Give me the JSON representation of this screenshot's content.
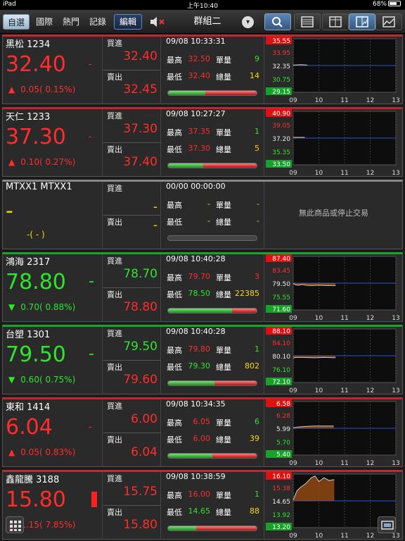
{
  "status": {
    "device": "iPad",
    "time": "上午10:40",
    "battery": "68%"
  },
  "toolbar": {
    "tabs": [
      {
        "label": "自選",
        "selected": true
      },
      {
        "label": "國際"
      },
      {
        "label": "熱門"
      },
      {
        "label": "記錄"
      }
    ],
    "edit_label": "編輯",
    "group_title": "群組二"
  },
  "colors": {
    "up": "#ff2d2d",
    "down": "#2ee52e",
    "volume": "#ffd800"
  },
  "labels": {
    "bid": "買進",
    "ask": "賣出",
    "high": "最高",
    "low": "最低",
    "single": "單量",
    "total": "總量"
  },
  "stocks": [
    {
      "name": "黑松 1234",
      "price": "32.40",
      "dir": "up",
      "change": "0.05",
      "pct": "( 0.15%)",
      "mark": "-",
      "bid": "32.40",
      "ask": "32.45",
      "time": "09/08 10:33:31",
      "high": "32.50",
      "low": "32.40",
      "single": "9",
      "total": "14",
      "bar_buy": 0.42,
      "chart": {
        "labels": [
          "35.55",
          "33.95",
          "32.35",
          "30.75",
          "29.15"
        ],
        "x_ticks": [
          "09",
          "10",
          "11",
          "12",
          "13"
        ],
        "ymax": 35.55,
        "ymin": 29.15,
        "ref": 32.35,
        "line": [
          [
            9.0,
            32.4
          ],
          [
            9.3,
            32.45
          ],
          [
            9.55,
            32.4
          ]
        ]
      }
    },
    {
      "name": "天仁 1233",
      "price": "37.30",
      "dir": "up",
      "change": "0.10",
      "pct": "( 0.27%)",
      "mark": "-",
      "bid": "37.30",
      "ask": "37.40",
      "time": "09/08 10:27:27",
      "high": "37.35",
      "low": "37.30",
      "single": "1",
      "total": "5",
      "bar_buy": 0.4,
      "chart": {
        "labels": [
          "40.90",
          "39.05",
          "37.20",
          "35.35",
          "33.50"
        ],
        "x_ticks": [
          "09",
          "10",
          "11",
          "12",
          "13"
        ],
        "ymax": 40.9,
        "ymin": 33.5,
        "ref": 37.2,
        "line": [
          [
            9.0,
            37.3
          ],
          [
            9.3,
            37.3
          ],
          [
            9.45,
            37.3
          ]
        ]
      }
    },
    {
      "name": "MTXX1 MTXX1",
      "price": "-",
      "dir": "none",
      "change": "",
      "pct": "-( - )",
      "mark": "",
      "bid": "-",
      "ask": "-",
      "time": "00/00 00:00:00",
      "high": "-",
      "low": "-",
      "single": "-",
      "total": "-",
      "bar_buy": null,
      "chart": null,
      "nodata": "無此商品或停止交易"
    },
    {
      "name": "鴻海 2317",
      "price": "78.80",
      "dir": "down",
      "change": "0.70",
      "pct": "( 0.88%)",
      "mark": "-",
      "bid": "78.70",
      "ask": "78.80",
      "time": "09/08 10:40:28",
      "high": "79.70",
      "low": "78.50",
      "single": "3",
      "total": "22385",
      "bar_buy": 0.72,
      "chart": {
        "labels": [
          "87.40",
          "83.45",
          "79.50",
          "75.55",
          "71.60"
        ],
        "x_ticks": [
          "09",
          "10",
          "11",
          "12",
          "13"
        ],
        "ymax": 87.4,
        "ymin": 71.6,
        "ref": 79.5,
        "line": [
          [
            9.0,
            79.4
          ],
          [
            9.1,
            79.0
          ],
          [
            9.2,
            78.9
          ],
          [
            9.35,
            79.1
          ],
          [
            9.5,
            78.9
          ],
          [
            9.7,
            78.8
          ],
          [
            10.0,
            78.9
          ],
          [
            10.3,
            78.8
          ],
          [
            10.65,
            78.8
          ]
        ]
      }
    },
    {
      "name": "台塑 1301",
      "price": "79.50",
      "dir": "down",
      "change": "0.60",
      "pct": "( 0.75%)",
      "mark": "-",
      "bid": "79.50",
      "ask": "79.60",
      "time": "09/08 10:40:28",
      "high": "79.80",
      "low": "79.30",
      "single": "1",
      "total": "802",
      "bar_buy": 0.52,
      "chart": {
        "labels": [
          "88.10",
          "84.10",
          "80.10",
          "76.10",
          "72.10"
        ],
        "x_ticks": [
          "09",
          "10",
          "11",
          "12",
          "13"
        ],
        "ymax": 88.1,
        "ymin": 72.1,
        "ref": 80.1,
        "line": [
          [
            9.0,
            79.4
          ],
          [
            9.1,
            79.6
          ],
          [
            9.4,
            79.6
          ],
          [
            9.8,
            79.5
          ],
          [
            10.2,
            79.6
          ],
          [
            10.65,
            79.5
          ]
        ]
      }
    },
    {
      "name": "東和 1414",
      "price": "6.04",
      "dir": "up",
      "change": "0.05",
      "pct": "( 0.83%)",
      "mark": "-",
      "bid": "6.00",
      "ask": "6.04",
      "time": "09/08 10:34:35",
      "high": "6.05",
      "low": "6.00",
      "single": "6",
      "total": "39",
      "bar_buy": 0.5,
      "chart": {
        "labels": [
          "6.58",
          "6.28",
          "5.99",
          "5.70",
          "5.40"
        ],
        "x_ticks": [
          "09",
          "10",
          "11",
          "12",
          "13"
        ],
        "ymax": 6.58,
        "ymin": 5.4,
        "ref": 5.99,
        "line": [
          [
            9.0,
            6.0
          ],
          [
            9.2,
            6.02
          ],
          [
            9.5,
            6.03
          ],
          [
            9.8,
            6.04
          ],
          [
            10.2,
            6.04
          ],
          [
            10.58,
            6.04
          ]
        ]
      }
    },
    {
      "name": "鑫龍騰 3188",
      "price": "15.80",
      "dir": "up",
      "change": "1.15",
      "pct": "( 7.85%)",
      "mark": "bar",
      "bid": "15.75",
      "ask": "15.80",
      "time": "09/08 10:38:59",
      "high": "16.00",
      "low": "14.65",
      "single": "1",
      "total": "88",
      "bar_buy": 0.32,
      "chart": {
        "labels": [
          "16.10",
          "15.38",
          "14.65",
          "13.92",
          "13.20"
        ],
        "x_ticks": [
          "09",
          "10",
          "11",
          "12",
          "13"
        ],
        "ymax": 16.1,
        "ymin": 13.2,
        "ref": 14.65,
        "line": [
          [
            9.0,
            14.7
          ],
          [
            9.15,
            15.2
          ],
          [
            9.3,
            15.4
          ],
          [
            9.5,
            15.6
          ],
          [
            9.7,
            15.9
          ],
          [
            9.85,
            16.0
          ],
          [
            10.0,
            15.7
          ],
          [
            10.2,
            15.9
          ],
          [
            10.4,
            15.75
          ],
          [
            10.6,
            15.8
          ]
        ]
      }
    }
  ]
}
